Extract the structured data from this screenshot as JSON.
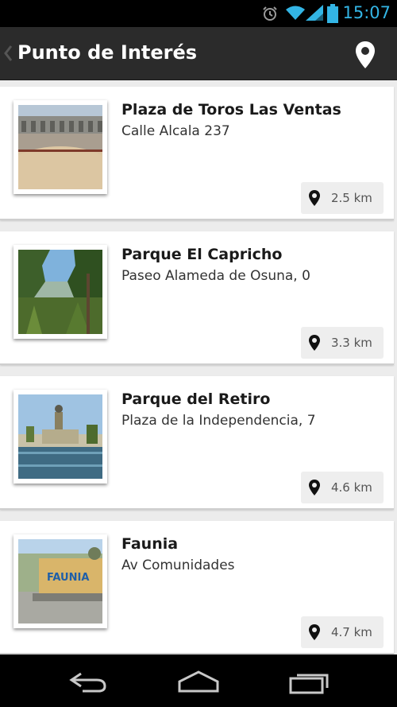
{
  "status_bar": {
    "time": "15:07",
    "icons": [
      "alarm-icon",
      "wifi-icon",
      "signal-icon",
      "battery-icon"
    ],
    "accent": "#33b5e5"
  },
  "action_bar": {
    "title": "Punto de Interés",
    "icons": [
      "back-caret-icon",
      "map-pin-icon"
    ],
    "background": "#2b2b2b"
  },
  "places": [
    {
      "name": "Plaza de Toros Las Ventas",
      "address": "Calle Alcala 237",
      "distance": "2.5 km",
      "image": "bullring"
    },
    {
      "name": "Parque El Capricho",
      "address": "Paseo Alameda de Osuna, 0",
      "distance": "3.3 km",
      "image": "forest"
    },
    {
      "name": "Parque del Retiro",
      "address": "Plaza de la Independencia, 7",
      "distance": "4.6 km",
      "image": "lake-monument"
    },
    {
      "name": "Faunia",
      "address": "Av Comunidades",
      "distance": "4.7 km",
      "image": "faunia-sign"
    }
  ],
  "nav_bar": {
    "icons": [
      "back-icon",
      "home-icon",
      "recent-apps-icon"
    ]
  }
}
